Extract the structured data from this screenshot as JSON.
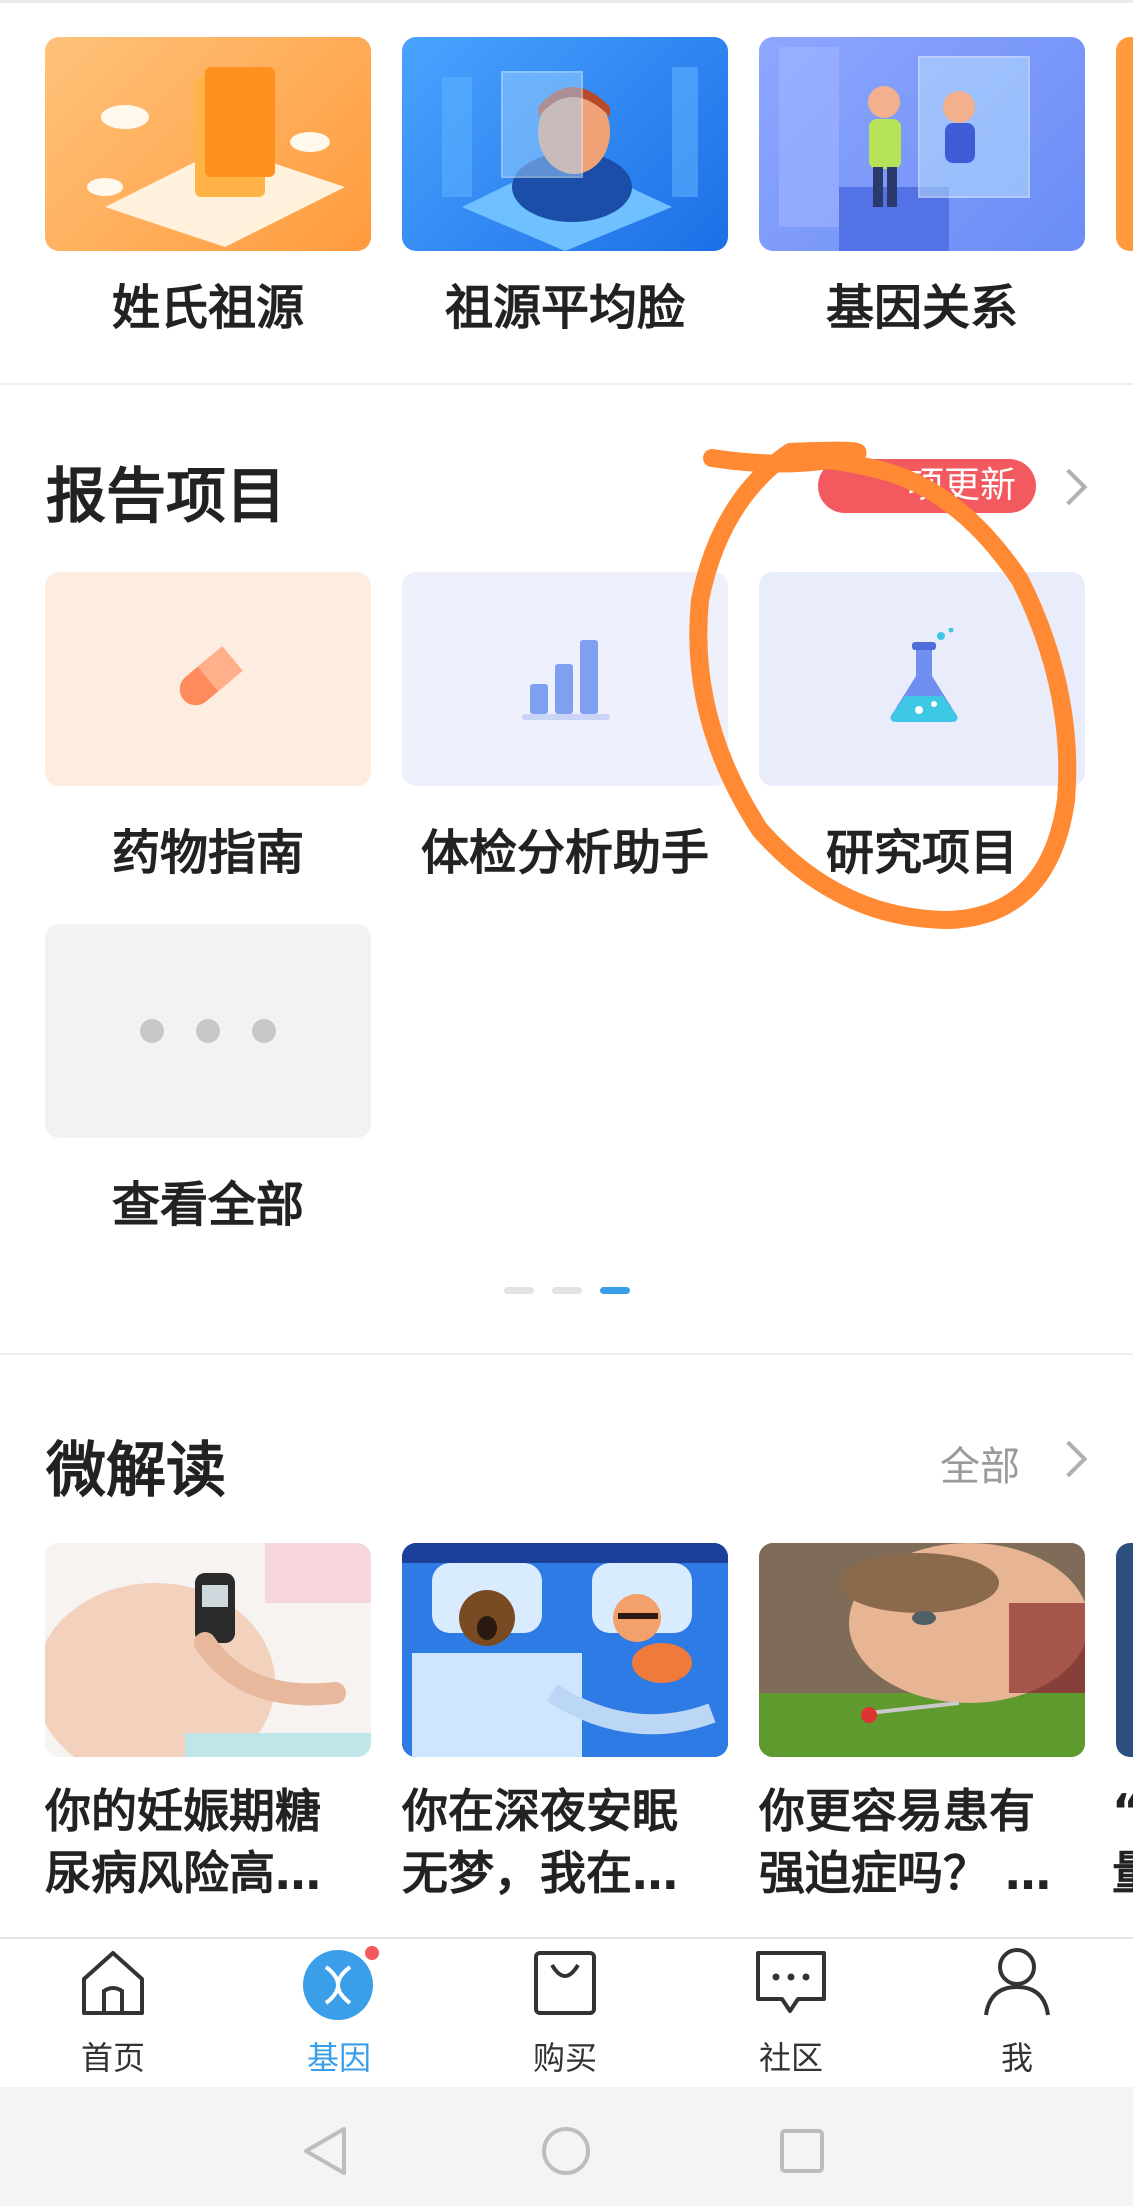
{
  "features": [
    {
      "label": "姓氏祖源",
      "icon": "surname-illustration"
    },
    {
      "label": "祖源平均脸",
      "icon": "face-illustration"
    },
    {
      "label": "基因关系",
      "icon": "relationship-illustration"
    }
  ],
  "report": {
    "title": "报告项目",
    "badge": "项更新",
    "items": [
      {
        "label": "药物指南",
        "icon": "pill-icon"
      },
      {
        "label": "体检分析助手",
        "icon": "bar-chart-icon"
      },
      {
        "label": "研究项目",
        "icon": "flask-icon"
      },
      {
        "label": "查看全部",
        "icon": "more-dots-icon"
      }
    ]
  },
  "micro": {
    "title": "微解读",
    "all_label": "全部",
    "articles": [
      {
        "title": "你的妊娠期糖\n尿病风险高…"
      },
      {
        "title": "你在深夜安眠\n无梦，我在…"
      },
      {
        "title": "你更容易患有\n强迫症吗？ …"
      },
      {
        "title": "“\n量"
      }
    ]
  },
  "tabs": [
    {
      "label": "首页",
      "icon": "home-icon"
    },
    {
      "label": "基因",
      "icon": "dna-icon"
    },
    {
      "label": "购买",
      "icon": "shopping-bag-icon"
    },
    {
      "label": "社区",
      "icon": "chat-icon"
    },
    {
      "label": "我",
      "icon": "person-icon"
    }
  ],
  "colors": {
    "accent": "#3a9ee9",
    "badge": "#f25a5f",
    "annotation": "#ff8a33"
  }
}
